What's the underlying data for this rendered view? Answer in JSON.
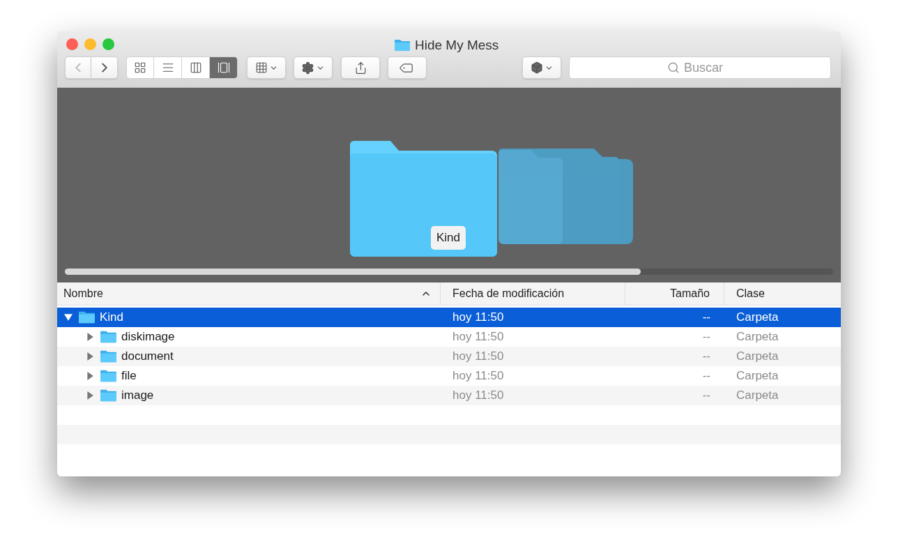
{
  "window": {
    "title": "Hide My Mess"
  },
  "toolbar": {
    "view_buttons": [
      {
        "kind": "icons",
        "selected": false
      },
      {
        "kind": "list",
        "selected": false
      },
      {
        "kind": "columns",
        "selected": false
      },
      {
        "kind": "coverflow",
        "selected": true
      }
    ]
  },
  "search": {
    "placeholder": "Buscar"
  },
  "coverflow": {
    "caption": "Kind"
  },
  "table": {
    "columns": [
      {
        "label": "Nombre",
        "sorted": true
      },
      {
        "label": "Fecha de modificación",
        "sorted": false
      },
      {
        "label": "Tamaño",
        "sorted": false
      },
      {
        "label": "Clase",
        "sorted": false
      }
    ],
    "rows": [
      {
        "name": "Kind",
        "date": "hoy 11:50",
        "size": "--",
        "kind": "Carpeta",
        "expanded": true,
        "selected": true,
        "children": [
          {
            "name": "diskimage",
            "date": "hoy 11:50",
            "size": "--",
            "kind": "Carpeta",
            "expanded": false,
            "selected": false
          },
          {
            "name": "document",
            "date": "hoy 11:50",
            "size": "--",
            "kind": "Carpeta",
            "expanded": false,
            "selected": false
          },
          {
            "name": "file",
            "date": "hoy 11:50",
            "size": "--",
            "kind": "Carpeta",
            "expanded": false,
            "selected": false
          },
          {
            "name": "image",
            "date": "hoy 11:50",
            "size": "--",
            "kind": "Carpeta",
            "expanded": false,
            "selected": false
          }
        ]
      }
    ]
  }
}
